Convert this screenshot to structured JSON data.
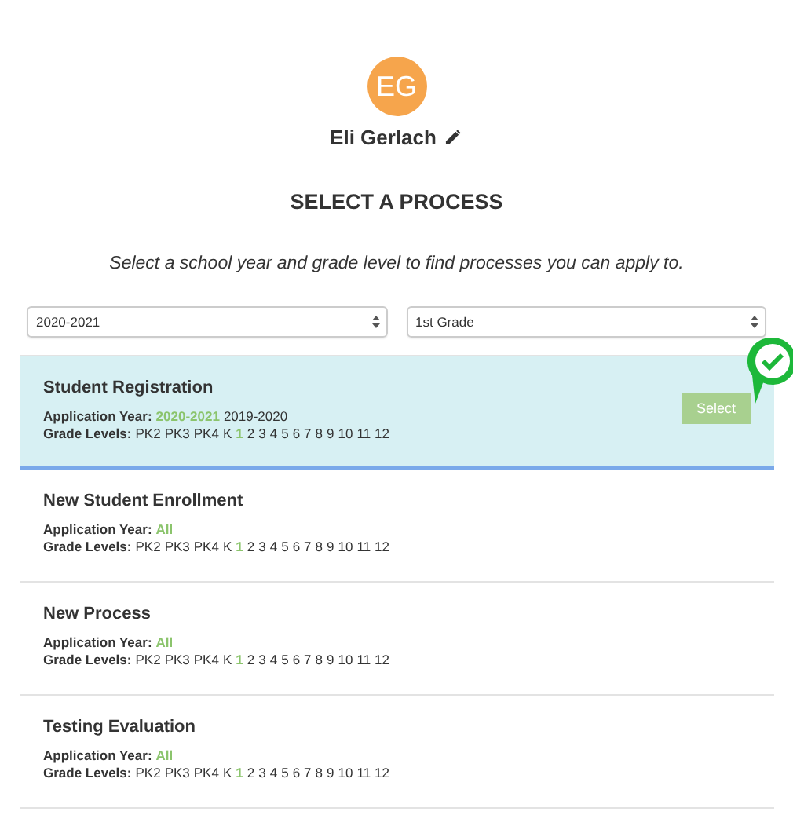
{
  "user": {
    "initials": "EG",
    "name": "Eli Gerlach"
  },
  "heading": "SELECT A PROCESS",
  "instructions": "Select a school year and grade level to find processes you can apply to.",
  "filters": [
    {
      "value": "2020-2021"
    },
    {
      "value": "1st Grade"
    }
  ],
  "processes": [
    {
      "title": "Student Registration",
      "selected": true,
      "action": "Select",
      "year_label": "Application Year:",
      "years": [
        {
          "label": "2020-2021",
          "selected": true
        },
        {
          "label": "2019-2020",
          "selected": false
        }
      ],
      "grade_label": "Grade Levels:",
      "grades": [
        {
          "label": "PK2",
          "selected": false
        },
        {
          "label": "PK3",
          "selected": false
        },
        {
          "label": "PK4",
          "selected": false
        },
        {
          "label": "K",
          "selected": false
        },
        {
          "label": "1",
          "selected": true
        },
        {
          "label": "2",
          "selected": false
        },
        {
          "label": "3",
          "selected": false
        },
        {
          "label": "4",
          "selected": false
        },
        {
          "label": "5",
          "selected": false
        },
        {
          "label": "6",
          "selected": false
        },
        {
          "label": "7",
          "selected": false
        },
        {
          "label": "8",
          "selected": false
        },
        {
          "label": "9",
          "selected": false
        },
        {
          "label": "10",
          "selected": false
        },
        {
          "label": "11",
          "selected": false
        },
        {
          "label": "12",
          "selected": false
        }
      ]
    },
    {
      "title": "New Student Enrollment",
      "selected": false,
      "year_label": "Application Year:",
      "years": [
        {
          "label": "All",
          "selected": true
        }
      ],
      "grade_label": "Grade Levels:",
      "grades": [
        {
          "label": "PK2",
          "selected": false
        },
        {
          "label": "PK3",
          "selected": false
        },
        {
          "label": "PK4",
          "selected": false
        },
        {
          "label": "K",
          "selected": false
        },
        {
          "label": "1",
          "selected": true
        },
        {
          "label": "2",
          "selected": false
        },
        {
          "label": "3",
          "selected": false
        },
        {
          "label": "4",
          "selected": false
        },
        {
          "label": "5",
          "selected": false
        },
        {
          "label": "6",
          "selected": false
        },
        {
          "label": "7",
          "selected": false
        },
        {
          "label": "8",
          "selected": false
        },
        {
          "label": "9",
          "selected": false
        },
        {
          "label": "10",
          "selected": false
        },
        {
          "label": "11",
          "selected": false
        },
        {
          "label": "12",
          "selected": false
        }
      ]
    },
    {
      "title": "New Process",
      "selected": false,
      "year_label": "Application Year:",
      "years": [
        {
          "label": "All",
          "selected": true
        }
      ],
      "grade_label": "Grade Levels:",
      "grades": [
        {
          "label": "PK2",
          "selected": false
        },
        {
          "label": "PK3",
          "selected": false
        },
        {
          "label": "PK4",
          "selected": false
        },
        {
          "label": "K",
          "selected": false
        },
        {
          "label": "1",
          "selected": true
        },
        {
          "label": "2",
          "selected": false
        },
        {
          "label": "3",
          "selected": false
        },
        {
          "label": "4",
          "selected": false
        },
        {
          "label": "5",
          "selected": false
        },
        {
          "label": "6",
          "selected": false
        },
        {
          "label": "7",
          "selected": false
        },
        {
          "label": "8",
          "selected": false
        },
        {
          "label": "9",
          "selected": false
        },
        {
          "label": "10",
          "selected": false
        },
        {
          "label": "11",
          "selected": false
        },
        {
          "label": "12",
          "selected": false
        }
      ]
    },
    {
      "title": "Testing Evaluation",
      "selected": false,
      "year_label": "Application Year:",
      "years": [
        {
          "label": "All",
          "selected": true
        }
      ],
      "grade_label": "Grade Levels:",
      "grades": [
        {
          "label": "PK2",
          "selected": false
        },
        {
          "label": "PK3",
          "selected": false
        },
        {
          "label": "PK4",
          "selected": false
        },
        {
          "label": "K",
          "selected": false
        },
        {
          "label": "1",
          "selected": true
        },
        {
          "label": "2",
          "selected": false
        },
        {
          "label": "3",
          "selected": false
        },
        {
          "label": "4",
          "selected": false
        },
        {
          "label": "5",
          "selected": false
        },
        {
          "label": "6",
          "selected": false
        },
        {
          "label": "7",
          "selected": false
        },
        {
          "label": "8",
          "selected": false
        },
        {
          "label": "9",
          "selected": false
        },
        {
          "label": "10",
          "selected": false
        },
        {
          "label": "11",
          "selected": false
        },
        {
          "label": "12",
          "selected": false
        }
      ]
    }
  ]
}
